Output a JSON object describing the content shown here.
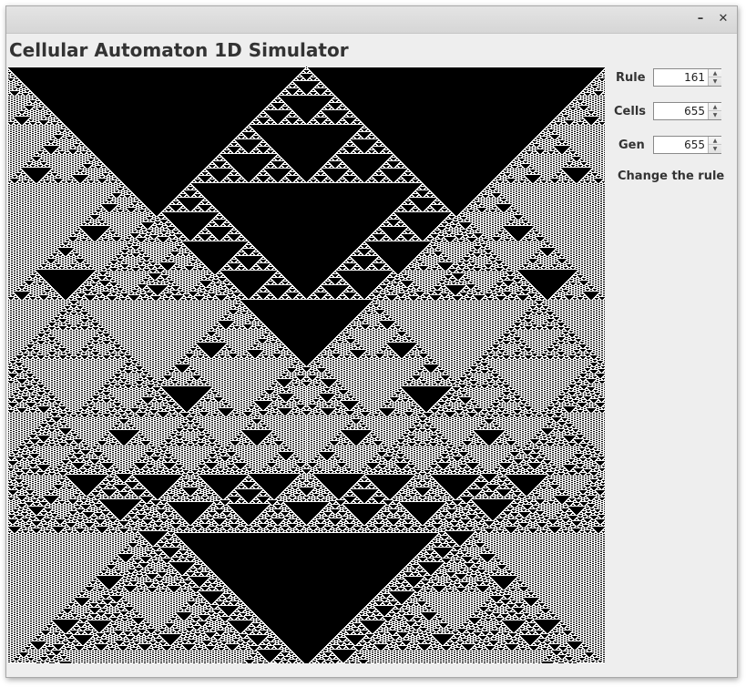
{
  "window": {
    "minimize_glyph": "–",
    "close_glyph": "✕"
  },
  "app": {
    "title": "Cellular Automaton 1D Simulator"
  },
  "controls": {
    "rule_label": "Rule",
    "rule_value": "161",
    "cells_label": "Cells",
    "cells_value": "655",
    "gen_label": "Gen",
    "gen_value": "655",
    "change_rule_label": "Change the rule"
  },
  "simulation": {
    "rule": 161,
    "cells": 655,
    "generations": 655,
    "alive_color": "#000000",
    "dead_color": "#ffffff"
  },
  "icons": {
    "spinner_up": "up-arrow-icon",
    "spinner_down": "down-arrow-icon"
  }
}
